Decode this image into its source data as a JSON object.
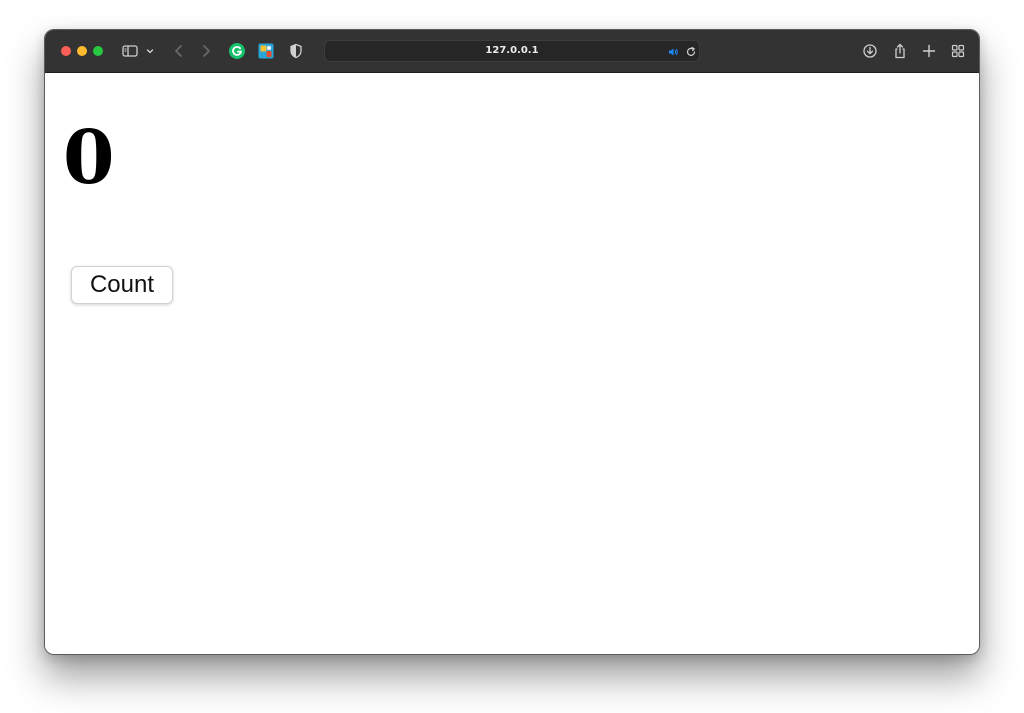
{
  "browser": {
    "address_bar": {
      "url": "127.0.0.1"
    },
    "toolbar_icons": [
      "sidebar-icon",
      "chevron-down-icon",
      "back-icon",
      "forward-icon",
      "grammarly-extension-icon",
      "extension-icon",
      "shield-icon",
      "speaker-icon",
      "reload-icon",
      "download-icon",
      "share-icon",
      "new-tab-icon",
      "tab-overview-icon"
    ],
    "colors": {
      "toolbar": "#333333",
      "close": "#ff5f57",
      "minimize": "#febc2e",
      "zoom": "#28c840",
      "grammarly": "#15c26b",
      "speaker": "#1a8cff"
    }
  },
  "page": {
    "counter_value": "0",
    "count_button_label": "Count"
  }
}
